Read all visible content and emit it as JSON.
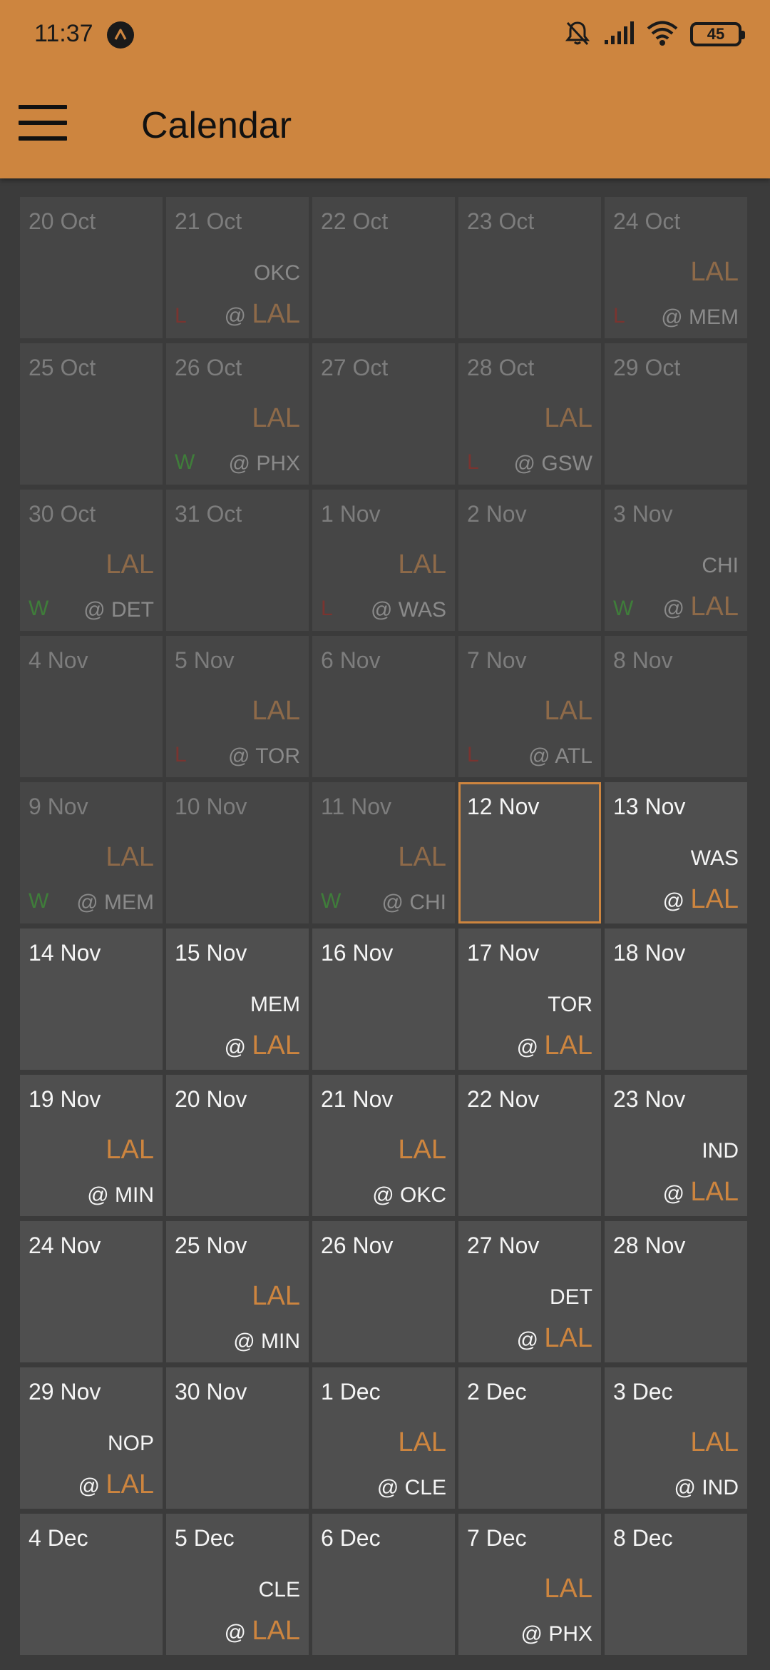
{
  "status_bar": {
    "time": "11:37",
    "battery": "45"
  },
  "app_bar": {
    "title": "Calendar"
  },
  "colors": {
    "accent": "#cd853f",
    "background": "#3b3b3b",
    "win": "#3f7d3a",
    "loss": "#7a3430"
  },
  "team": "LAL",
  "days": [
    {
      "date": "20 Oct",
      "past": true
    },
    {
      "date": "21 Oct",
      "past": true,
      "home": true,
      "opponent": "OKC",
      "result": "L"
    },
    {
      "date": "22 Oct",
      "past": true
    },
    {
      "date": "23 Oct",
      "past": true
    },
    {
      "date": "24 Oct",
      "past": true,
      "home": false,
      "opponent": "MEM",
      "result": "L"
    },
    {
      "date": "25 Oct",
      "past": true
    },
    {
      "date": "26 Oct",
      "past": true,
      "home": false,
      "opponent": "PHX",
      "result": "W"
    },
    {
      "date": "27 Oct",
      "past": true
    },
    {
      "date": "28 Oct",
      "past": true,
      "home": false,
      "opponent": "GSW",
      "result": "L"
    },
    {
      "date": "29 Oct",
      "past": true
    },
    {
      "date": "30 Oct",
      "past": true,
      "home": false,
      "opponent": "DET",
      "result": "W"
    },
    {
      "date": "31 Oct",
      "past": true
    },
    {
      "date": "1 Nov",
      "past": true,
      "home": false,
      "opponent": "WAS",
      "result": "L"
    },
    {
      "date": "2 Nov",
      "past": true
    },
    {
      "date": "3 Nov",
      "past": true,
      "home": true,
      "opponent": "CHI",
      "result": "W"
    },
    {
      "date": "4 Nov",
      "past": true
    },
    {
      "date": "5 Nov",
      "past": true,
      "home": false,
      "opponent": "TOR",
      "result": "L"
    },
    {
      "date": "6 Nov",
      "past": true
    },
    {
      "date": "7 Nov",
      "past": true,
      "home": false,
      "opponent": "ATL",
      "result": "L"
    },
    {
      "date": "8 Nov",
      "past": true
    },
    {
      "date": "9 Nov",
      "past": true,
      "home": false,
      "opponent": "MEM",
      "result": "W"
    },
    {
      "date": "10 Nov",
      "past": true
    },
    {
      "date": "11 Nov",
      "past": true,
      "home": false,
      "opponent": "CHI",
      "result": "W"
    },
    {
      "date": "12 Nov",
      "today": true
    },
    {
      "date": "13 Nov",
      "home": true,
      "opponent": "WAS"
    },
    {
      "date": "14 Nov"
    },
    {
      "date": "15 Nov",
      "home": true,
      "opponent": "MEM"
    },
    {
      "date": "16 Nov"
    },
    {
      "date": "17 Nov",
      "home": true,
      "opponent": "TOR"
    },
    {
      "date": "18 Nov"
    },
    {
      "date": "19 Nov",
      "home": false,
      "opponent": "MIN"
    },
    {
      "date": "20 Nov"
    },
    {
      "date": "21 Nov",
      "home": false,
      "opponent": "OKC"
    },
    {
      "date": "22 Nov"
    },
    {
      "date": "23 Nov",
      "home": true,
      "opponent": "IND"
    },
    {
      "date": "24 Nov"
    },
    {
      "date": "25 Nov",
      "home": false,
      "opponent": "MIN"
    },
    {
      "date": "26 Nov"
    },
    {
      "date": "27 Nov",
      "home": true,
      "opponent": "DET"
    },
    {
      "date": "28 Nov"
    },
    {
      "date": "29 Nov",
      "home": true,
      "opponent": "NOP"
    },
    {
      "date": "30 Nov"
    },
    {
      "date": "1 Dec",
      "home": false,
      "opponent": "CLE"
    },
    {
      "date": "2 Dec"
    },
    {
      "date": "3 Dec",
      "home": false,
      "opponent": "IND"
    },
    {
      "date": "4 Dec"
    },
    {
      "date": "5 Dec",
      "home": true,
      "opponent": "CLE"
    },
    {
      "date": "6 Dec"
    },
    {
      "date": "7 Dec",
      "home": false,
      "opponent": "PHX"
    },
    {
      "date": "8 Dec"
    }
  ]
}
